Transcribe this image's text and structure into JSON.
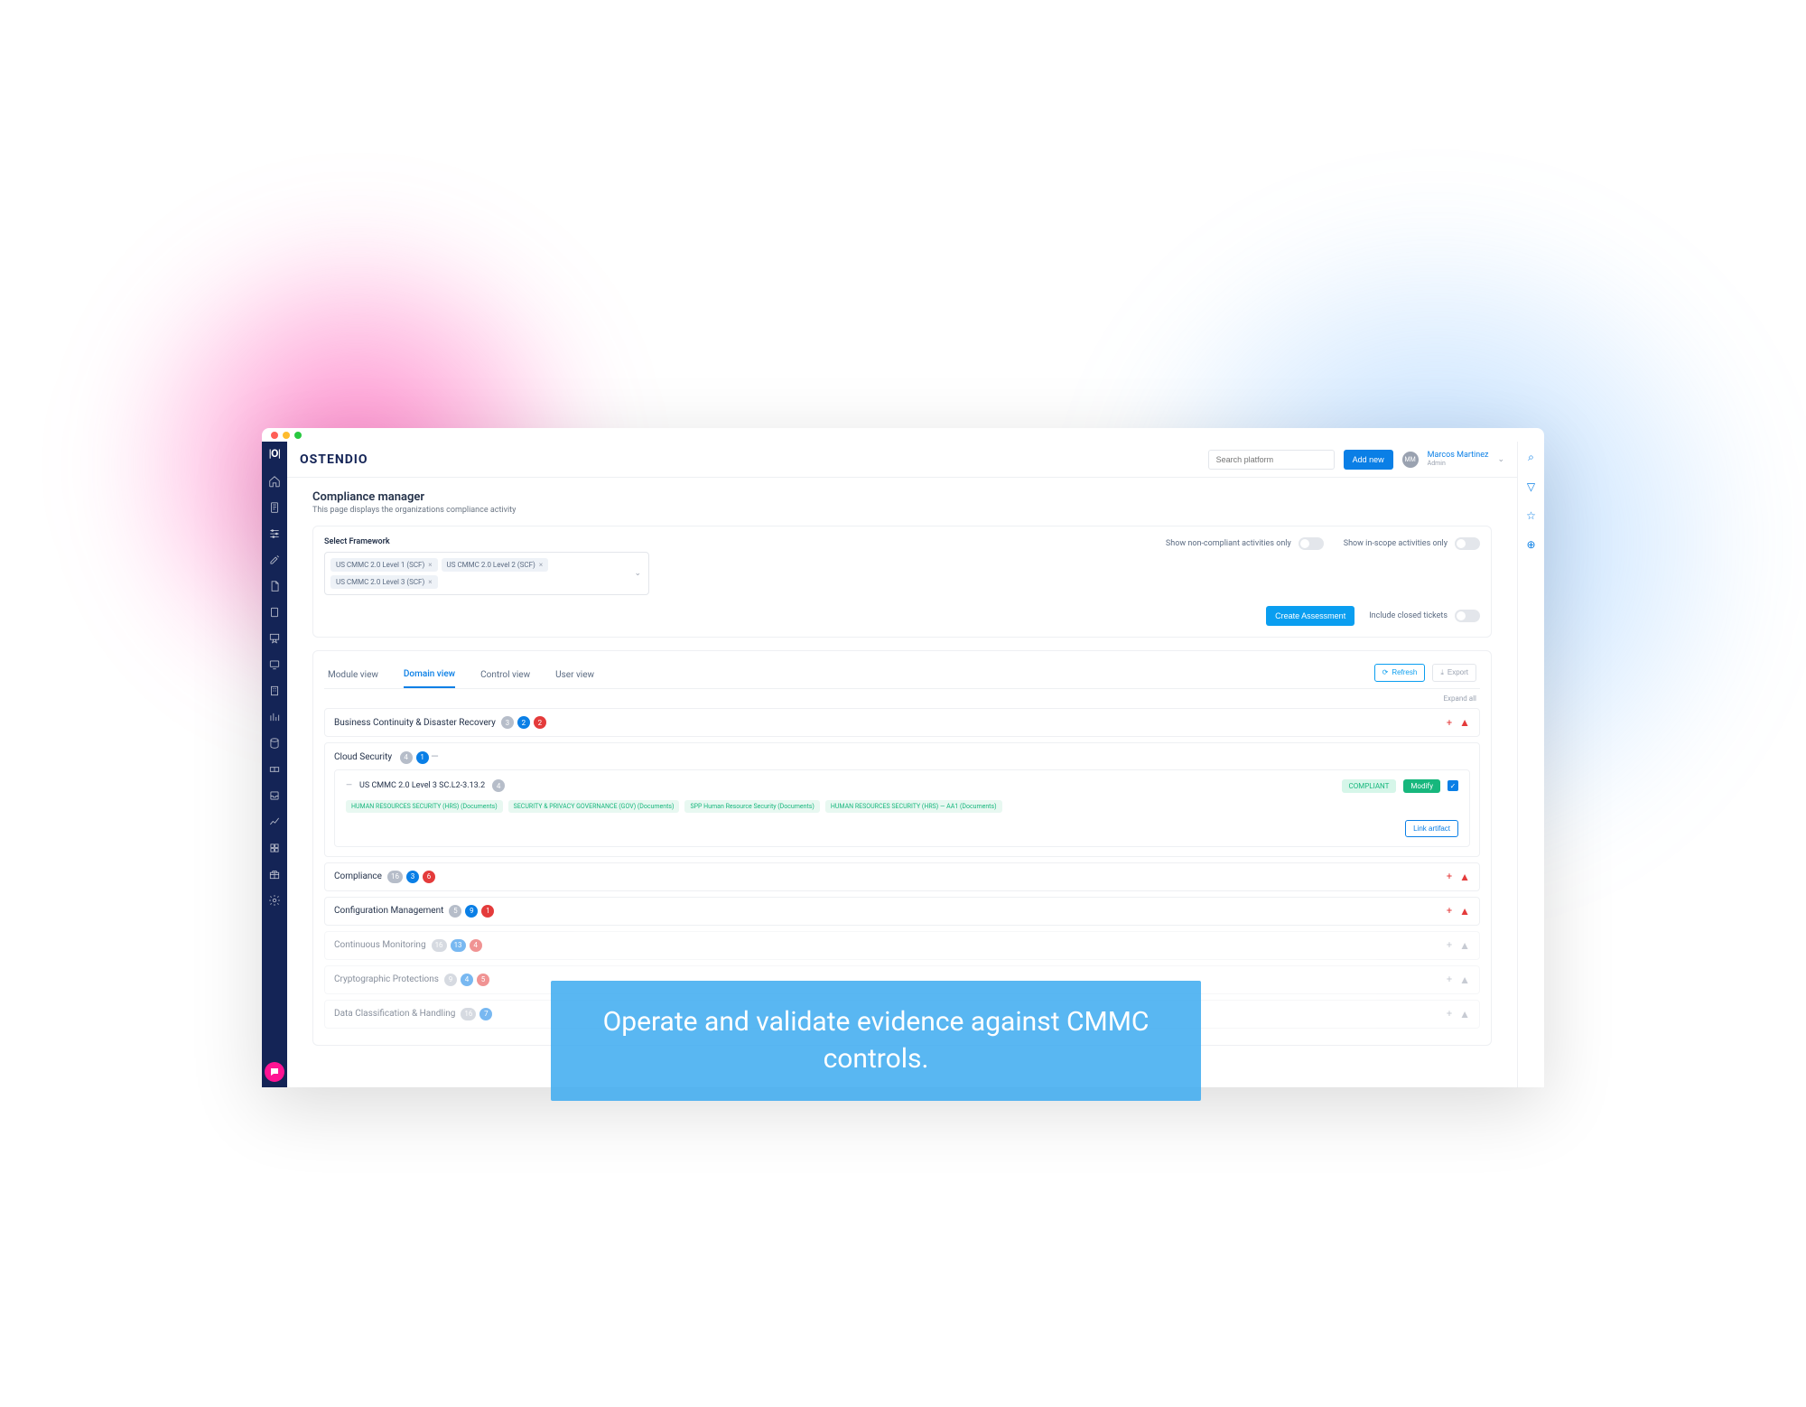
{
  "brand": "OSTENDIO",
  "search_placeholder": "Search platform",
  "add_new_label": "Add new",
  "user": {
    "initials": "MM",
    "name": "Marcos Martinez",
    "role": "Admin"
  },
  "page": {
    "title": "Compliance manager",
    "subtitle": "This page displays the organizations compliance activity"
  },
  "filters": {
    "select_framework_label": "Select Framework",
    "frameworks": [
      "US CMMC 2.0 Level 1 (SCF)",
      "US CMMC 2.0 Level 2 (SCF)",
      "US CMMC 2.0 Level 3 (SCF)"
    ],
    "toggle_noncompliant": "Show non-compliant activities only",
    "toggle_inscope": "Show in-scope activities only",
    "create_assessment": "Create Assessment",
    "toggle_closed": "Include closed tickets"
  },
  "tabs": {
    "items": [
      "Module view",
      "Domain view",
      "Control view",
      "User view"
    ],
    "active": "Domain view",
    "refresh": "Refresh",
    "export": "Export",
    "expand_all": "Expand all"
  },
  "domains": [
    {
      "name": "Business Continuity & Disaster Recovery",
      "counts": [
        3,
        2,
        2
      ],
      "alert": true
    },
    {
      "name": "Cloud Security",
      "counts": [
        4,
        1
      ],
      "expanded": true,
      "control": {
        "title": "US CMMC 2.0 Level 3 SC.L2-3.13.2",
        "count": 4,
        "status": "COMPLIANT",
        "modify": "Modify",
        "checked": true,
        "artifacts": [
          "HUMAN RESOURCES SECURITY (HRS) (Documents)",
          "SECURITY & PRIVACY GOVERNANCE (GOV) (Documents)",
          "SPP Human Resource Security (Documents)",
          "HUMAN RESOURCES SECURITY (HRS) — AA1 (Documents)"
        ],
        "link_artifact": "Link artifact"
      }
    },
    {
      "name": "Compliance",
      "counts": [
        16,
        3,
        6
      ],
      "alert": true
    },
    {
      "name": "Configuration Management",
      "counts": [
        5,
        9,
        1
      ],
      "alert": true
    },
    {
      "name": "Continuous Monitoring",
      "counts": [
        16,
        13,
        4
      ],
      "alert": true,
      "faded": true
    },
    {
      "name": "Cryptographic Protections",
      "counts": [
        9,
        4,
        5
      ],
      "alert": true,
      "faded": true
    },
    {
      "name": "Data Classification & Handling",
      "counts": [
        16,
        7
      ],
      "alert": true,
      "faded": true
    }
  ],
  "overlay_text": "Operate and validate evidence against CMMC controls."
}
